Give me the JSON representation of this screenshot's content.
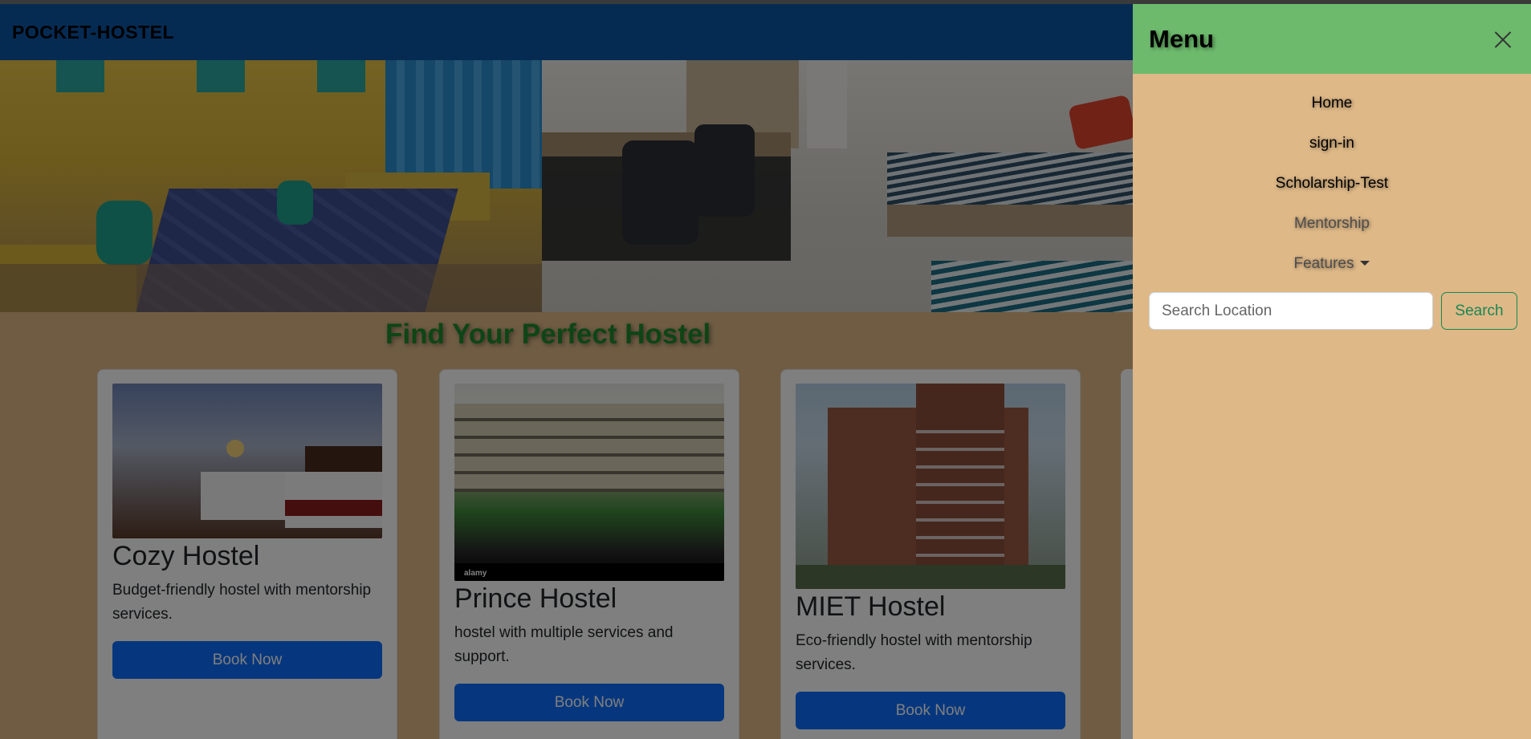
{
  "navbar": {
    "brand": "POCKET-HOSTEL"
  },
  "main": {
    "section_title": "Find Your Perfect Hostel",
    "cards": [
      {
        "title": "Cozy Hostel",
        "description": "Budget-friendly hostel with mentorship services.",
        "button": "Book Now"
      },
      {
        "title": "Prince Hostel",
        "description": "hostel with multiple services and support.",
        "button": "Book Now",
        "watermark": "alamy"
      },
      {
        "title": "MIET Hostel",
        "description": "Eco-friendly hostel with mentorship services.",
        "button": "Book Now"
      }
    ]
  },
  "offcanvas": {
    "title": "Menu",
    "links": [
      "Home",
      "sign-in",
      "Scholarship-Test",
      "Mentorship",
      "Features"
    ],
    "search": {
      "placeholder": "Search Location",
      "button": "Search"
    }
  },
  "colors": {
    "navbar": "#0d56a6",
    "offcanvas_header": "#6dba6d",
    "offcanvas_body": "#deb887",
    "primary_button": "#0d6efd",
    "search_button": "#198754",
    "title_green": "#1c8a2c"
  }
}
